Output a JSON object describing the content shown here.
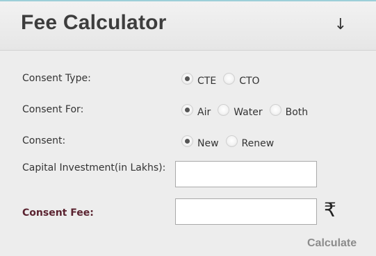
{
  "header": {
    "title": "Fee Calculator",
    "toggle_icon": "↓"
  },
  "fields": {
    "consent_type": {
      "label": "Consent Type:",
      "options": [
        "CTE",
        "CTO"
      ],
      "selected": "CTE"
    },
    "consent_for": {
      "label": "Consent For:",
      "options": [
        "Air",
        "Water",
        "Both"
      ],
      "selected": "Air"
    },
    "consent": {
      "label": "Consent:",
      "options": [
        "New",
        "Renew"
      ],
      "selected": "New"
    },
    "capital_investment": {
      "label": "Capital Investment(in Lakhs):",
      "value": ""
    },
    "consent_fee": {
      "label": "Consent Fee:",
      "value": "",
      "currency_symbol": "₹"
    }
  },
  "actions": {
    "calculate_label": "Calculate"
  }
}
